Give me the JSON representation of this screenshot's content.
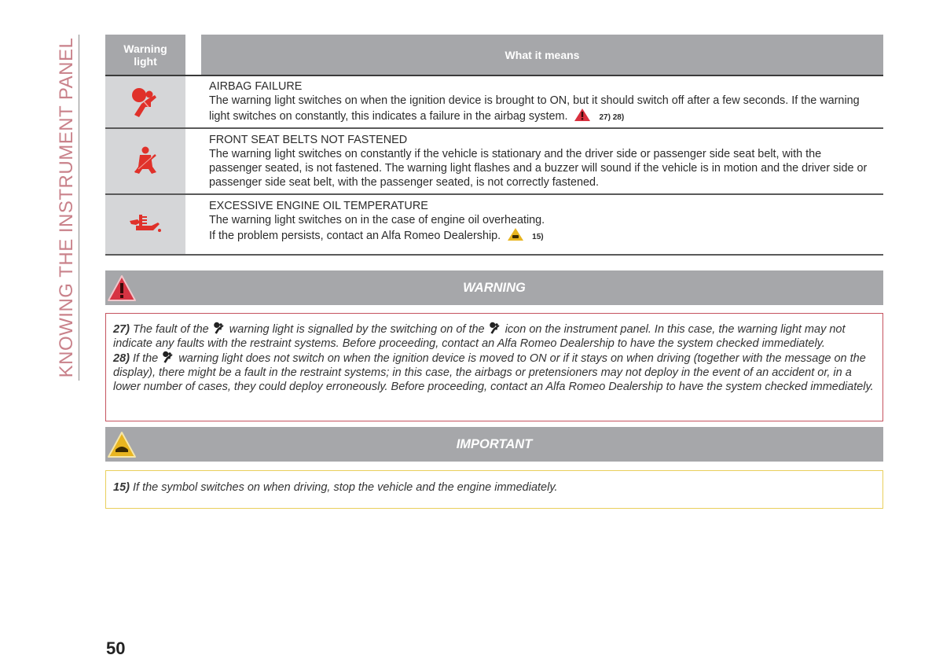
{
  "section_title": "KNOWING THE INSTRUMENT PANEL",
  "table": {
    "headers": {
      "warning_light": "Warning light",
      "meaning": "What it means"
    },
    "rows": [
      {
        "icon": "airbag-warning-icon",
        "title": "AIRBAG FAILURE",
        "text": "The warning light switches on when the ignition device is brought to ON, but it should switch off after a few seconds. If the warning light switches on constantly, this indicates a failure in the airbag system.",
        "ref_icon": "warning-triangle-icon",
        "refs": "27) 28)"
      },
      {
        "icon": "seat-belt-icon",
        "title": "FRONT SEAT BELTS NOT FASTENED",
        "text": "The warning light switches on constantly if the vehicle is stationary and the driver side or passenger side seat belt, with the passenger seated, is not fastened. The warning light flashes and a buzzer will sound if the vehicle is in motion and the driver side or passenger side seat belt, with the passenger seated, is not correctly fastened.",
        "ref_icon": "",
        "refs": ""
      },
      {
        "icon": "engine-oil-temperature-icon",
        "title": "EXCESSIVE ENGINE OIL TEMPERATURE",
        "text": "The warning light switches on in the case of engine oil overheating.",
        "text2": "If the problem persists, contact an Alfa Romeo Dealership.",
        "ref_icon": "important-triangle-icon",
        "refs": "15)"
      }
    ]
  },
  "warning": {
    "heading": "WARNING",
    "notes": [
      {
        "num": "27)",
        "pre": "The fault of the",
        "post": "warning light is signalled by the switching on of the",
        "post2": "icon on the instrument panel. In this case, the warning light may not indicate any faults with the restraint systems. Before proceeding, contact an Alfa Romeo Dealership to have the system checked immediately."
      },
      {
        "num": "28)",
        "pre": "If the",
        "post": "warning light does not switch on when the ignition device is moved to ON or if it stays on when driving (together with the message on the display), there might be a fault in the restraint systems; in this case, the airbags or pretensioners may not deploy in the event of an accident or, in a lower number of cases, they could deploy erroneously. Before proceeding, contact an Alfa Romeo Dealership to have the system checked immediately."
      }
    ]
  },
  "important": {
    "heading": "IMPORTANT",
    "notes": [
      {
        "num": "15)",
        "text": "If the symbol switches on when driving, stop the vehicle and the engine immediately."
      }
    ]
  },
  "page_number": "50",
  "colors": {
    "banner_gray": "#a6a7aa",
    "icon_red": "#e0312a",
    "warning_border": "#c5535f",
    "important_border": "#e9cf5c",
    "side_title": "#c9818a"
  }
}
